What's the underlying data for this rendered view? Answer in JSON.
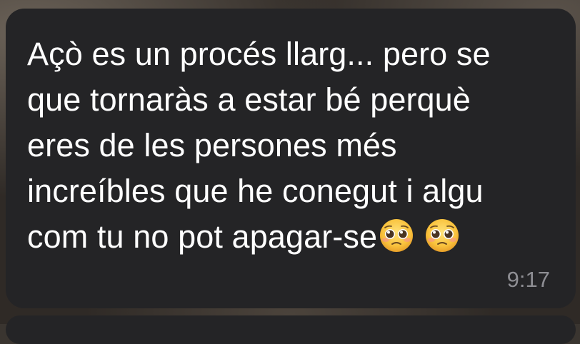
{
  "message": {
    "line1": "Açò es un procés llarg... pero se",
    "line2": "que tornaràs a estar bé perquè",
    "line3": "eres de les persones més",
    "line4": "increíbles que he conegut i algu",
    "line5": "com tu no pot apagar-se",
    "emojis": [
      "pleading-face-emoji",
      "pleading-face-emoji"
    ],
    "time": "9:17"
  },
  "colors": {
    "bubble": "#242426",
    "text": "#ffffff",
    "timestamp": "#8e8e93"
  }
}
